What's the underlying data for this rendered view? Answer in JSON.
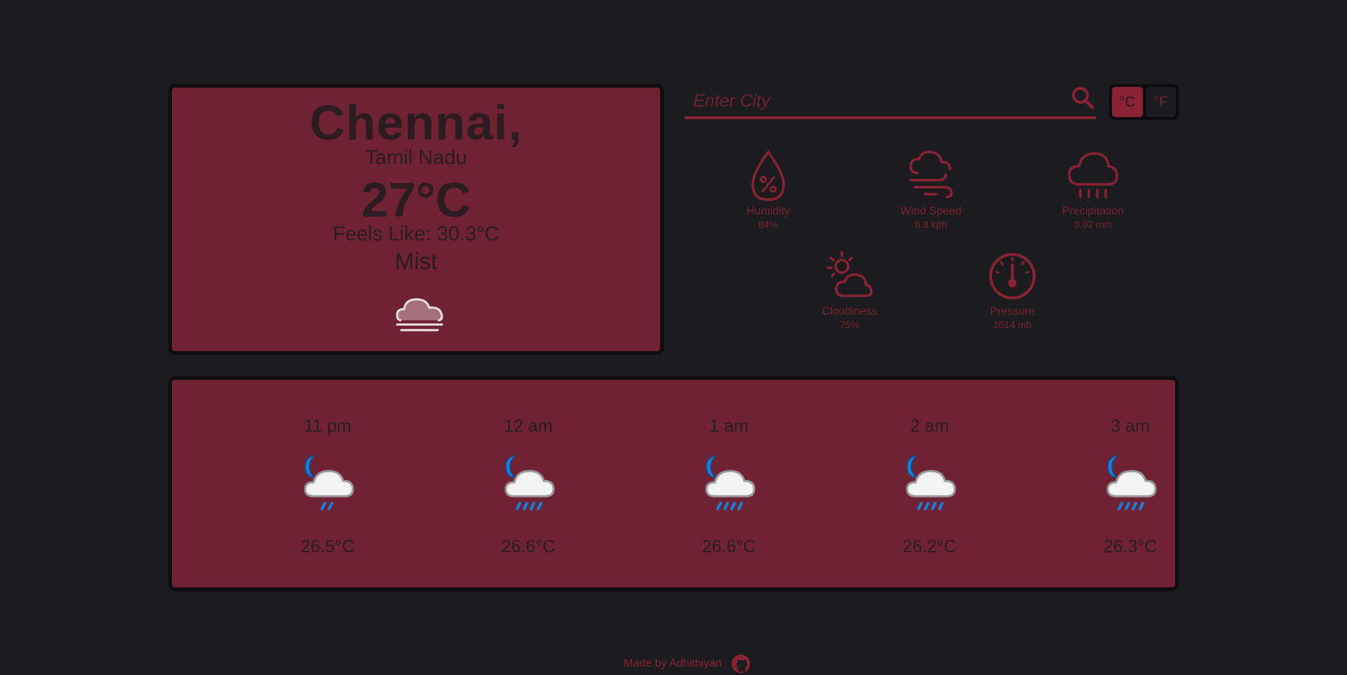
{
  "current": {
    "city": "Chennai,",
    "region": "Tamil Nadu",
    "temperature": "27°C",
    "feels_like": "Feels Like: 30.3°C",
    "condition": "Mist",
    "condition_icon": "mist-cloud-icon"
  },
  "search": {
    "placeholder": "Enter City",
    "value": ""
  },
  "units": {
    "celsius": "°C",
    "fahrenheit": "°F",
    "selected": "celsius"
  },
  "stats": [
    {
      "label": "Humidity",
      "value": "84%",
      "icon": "humidity-icon"
    },
    {
      "label": "Wind Speed",
      "value": "6.8 kph",
      "icon": "wind-icon"
    },
    {
      "label": "Precipitation",
      "value": "0.02 mm",
      "icon": "precipitation-icon"
    },
    {
      "label": "Cloudiness",
      "value": "75%",
      "icon": "cloudiness-icon"
    },
    {
      "label": "Pressure",
      "value": "1014 mb",
      "icon": "pressure-icon"
    }
  ],
  "forecast": [
    {
      "time": "11 pm",
      "temp": "26.5°C",
      "icon": "night-rain-icon"
    },
    {
      "time": "12 am",
      "temp": "26.6°C",
      "icon": "night-rain-icon"
    },
    {
      "time": "1 am",
      "temp": "26.6°C",
      "icon": "night-rain-icon"
    },
    {
      "time": "2 am",
      "temp": "26.2°C",
      "icon": "night-rain-icon"
    },
    {
      "time": "3 am",
      "temp": "26.3°C",
      "icon": "night-rain-icon"
    }
  ],
  "footer": {
    "text": "Made by Adhithiyan",
    "icon": "github-icon"
  },
  "colors": {
    "background": "#1c1c1e",
    "card": "#6e2233",
    "accent": "#8a2236",
    "text_dark": "#2a1c20"
  }
}
